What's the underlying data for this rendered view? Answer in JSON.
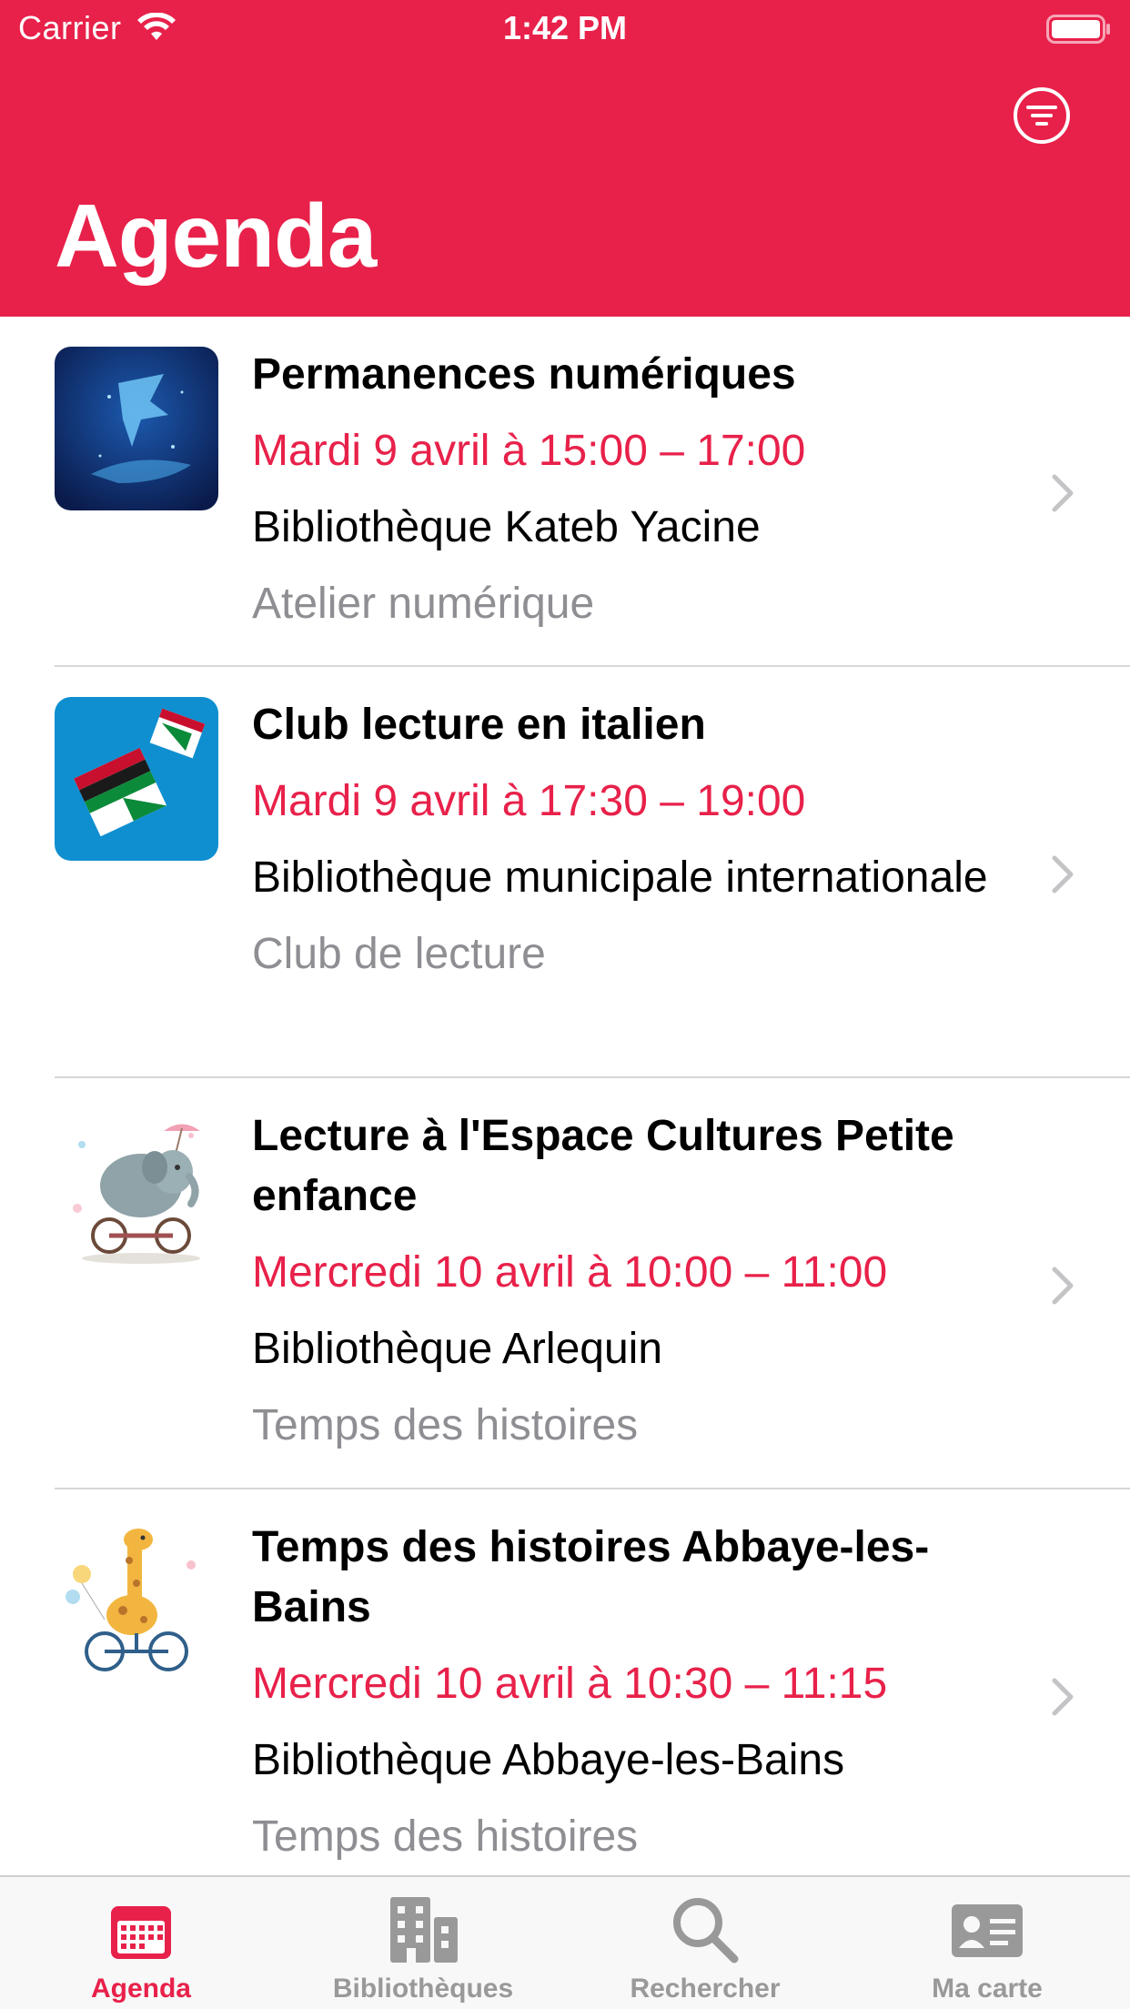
{
  "status_bar": {
    "carrier": "Carrier",
    "time": "1:42 PM"
  },
  "header": {
    "title": "Agenda",
    "filter_icon": "filter-icon",
    "background_color": "#e8214a"
  },
  "events": [
    {
      "title": "Permanences numériques",
      "date": "Mardi 9 avril à 15:00 – 17:00",
      "venue": "Bibliothèque Kateb Yacine",
      "category": "Atelier numérique",
      "thumbnail": "digital-bird-hand-image"
    },
    {
      "title": "Club lecture en italien",
      "date": "Mardi 9 avril à 17:30 – 19:00",
      "venue": "Bibliothèque municipale internationale",
      "category": "Club de lecture",
      "thumbnail": "books-flying-image"
    },
    {
      "title": "Lecture à l'Espace Cultures Petite enfance",
      "date": "Mercredi 10 avril à 10:00 – 11:00",
      "venue": "Bibliothèque Arlequin",
      "category": "Temps des histoires",
      "thumbnail": "elephant-bicycle-image"
    },
    {
      "title": "Temps des histoires Abbaye-les-Bains",
      "date": "Mercredi 10 avril à 10:30 – 11:15",
      "venue": "Bibliothèque Abbaye-les-Bains",
      "category": "Temps des histoires",
      "thumbnail": "giraffe-bicycle-image"
    }
  ],
  "tabs": [
    {
      "label": "Agenda",
      "icon": "calendar-icon",
      "active": true
    },
    {
      "label": "Bibliothèques",
      "icon": "buildings-icon",
      "active": false
    },
    {
      "label": "Rechercher",
      "icon": "search-icon",
      "active": false
    },
    {
      "label": "Ma carte",
      "icon": "id-card-icon",
      "active": false
    }
  ],
  "colors": {
    "accent": "#e8214a",
    "secondary_text": "#8e8e93",
    "tab_inactive": "#999999"
  }
}
